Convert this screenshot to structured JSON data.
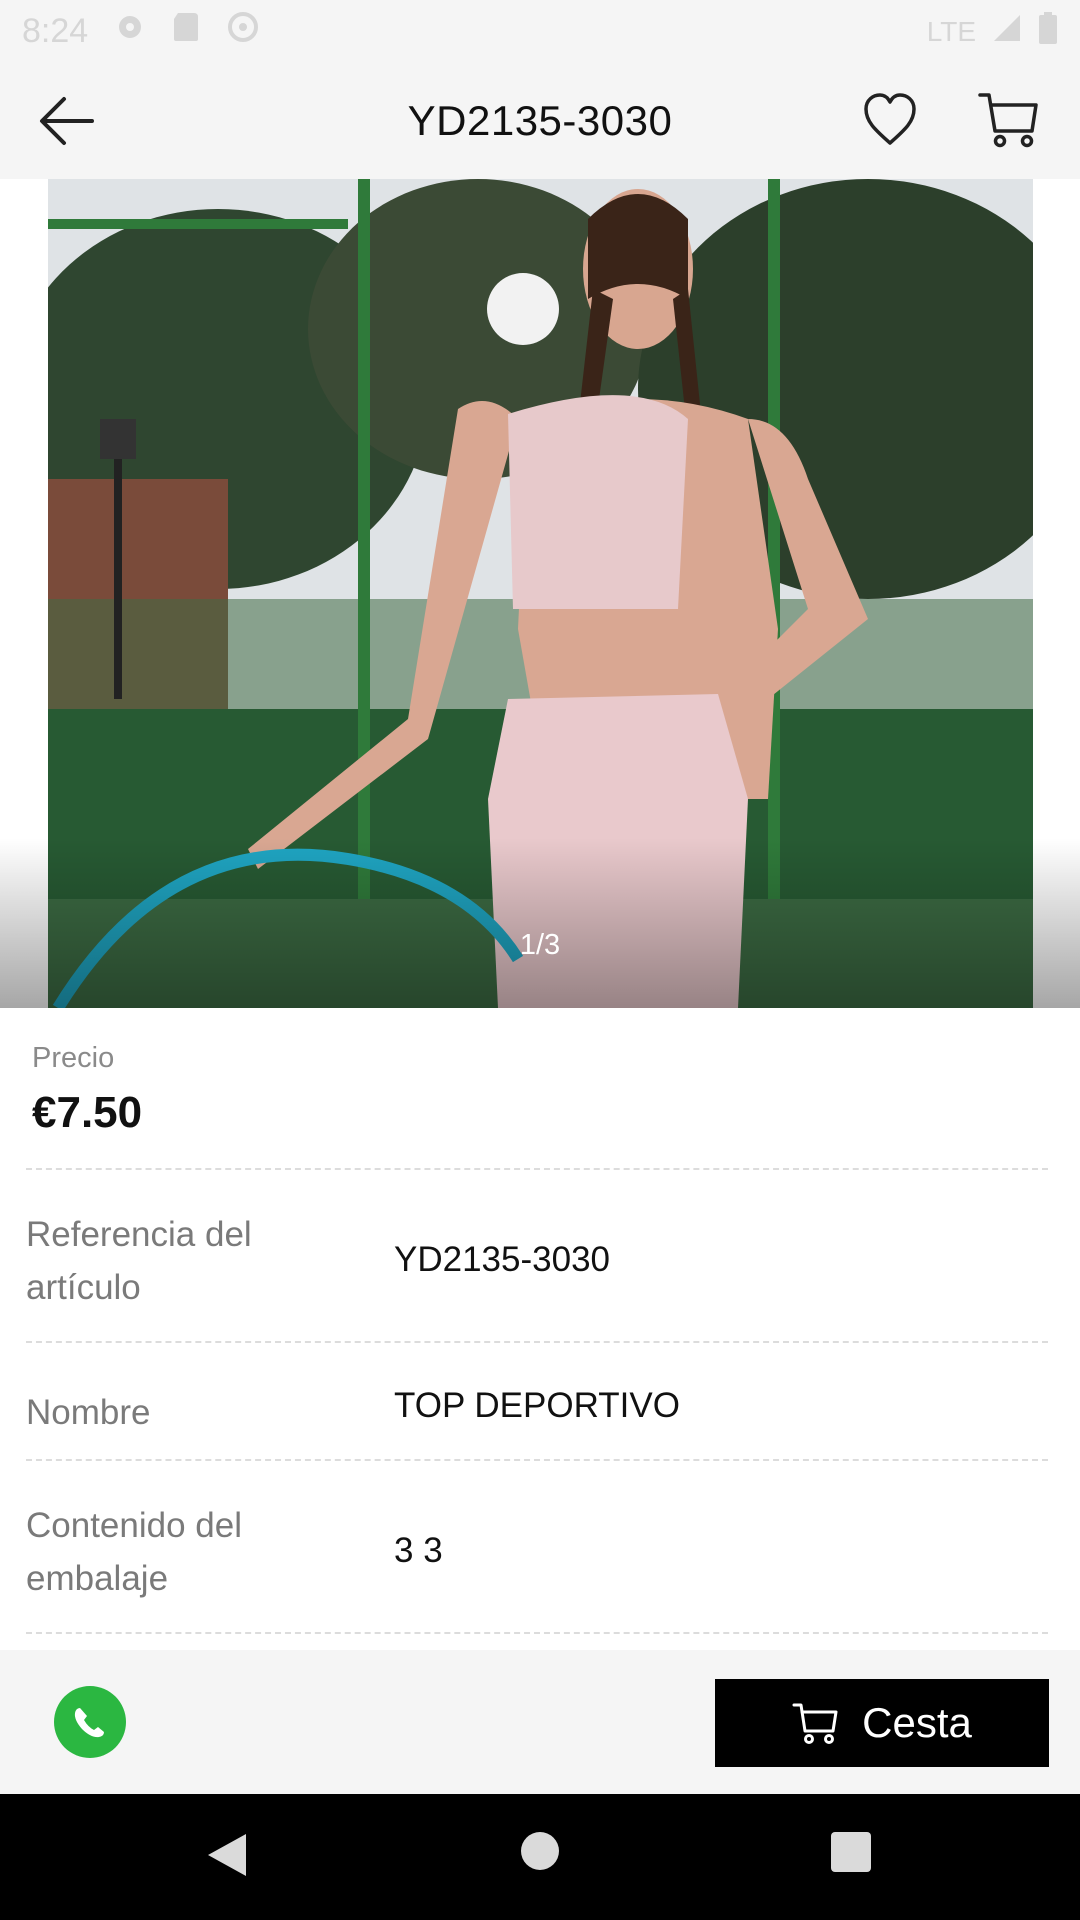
{
  "status_bar": {
    "time": "8:24",
    "network": "LTE"
  },
  "header": {
    "title": "YD2135-3030"
  },
  "carousel": {
    "indicator": "1/3",
    "current": 1,
    "total": 3
  },
  "price": {
    "label": "Precio",
    "value": "€7.50"
  },
  "details": [
    {
      "label": "Referencia del artículo",
      "value": "YD2135-3030"
    },
    {
      "label": "Nombre",
      "value": "TOP DEPORTIVO"
    },
    {
      "label": "Contenido del embalaje",
      "value": "3 3"
    }
  ],
  "actions": {
    "basket_label": "Cesta"
  },
  "colors": {
    "accent": "#000000",
    "whatsapp": "#2bb741",
    "header_bg": "#f5f5f5"
  },
  "icons": [
    "back-arrow-icon",
    "heart-icon",
    "cart-icon",
    "whatsapp-icon",
    "basket-cart-icon"
  ]
}
